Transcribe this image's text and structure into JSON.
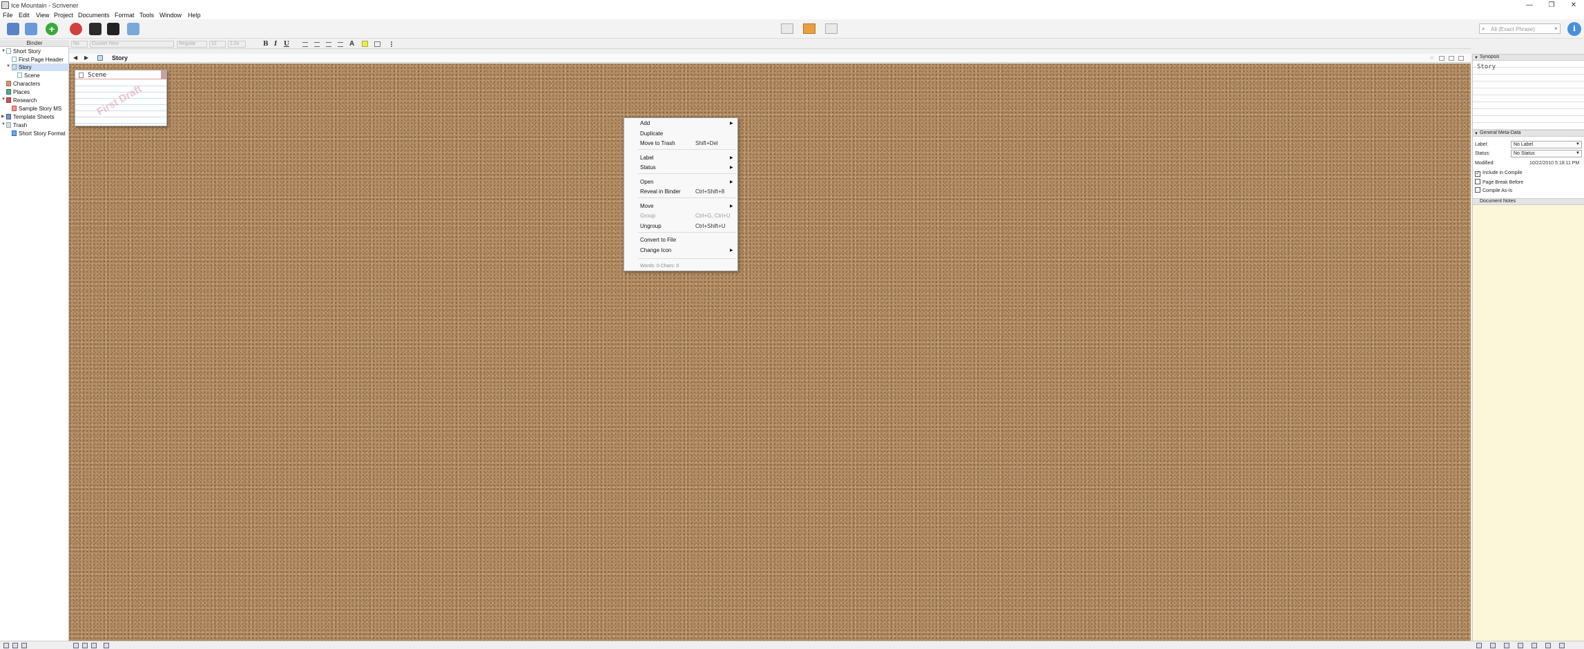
{
  "window": {
    "title": "Ice Mountain - Scrivener",
    "controls": {
      "minimize": "—",
      "maximize": "❐",
      "close": "✕"
    }
  },
  "menubar": [
    "File",
    "Edit",
    "View",
    "Project",
    "Documents",
    "Format",
    "Tools",
    "Window",
    "Help"
  ],
  "toolbar": {
    "search_placeholder": "All (Exact Phrase)",
    "info_label": "i",
    "colors": {
      "add": "#3aa83a",
      "remove": "#d04040",
      "info": "#4a90d9",
      "view_active": "#e8a040"
    }
  },
  "binder": {
    "header": "Binder",
    "items": [
      {
        "label": "Short Story"
      },
      {
        "label": "First Page Header"
      },
      {
        "label": "Story"
      },
      {
        "label": "Scene"
      },
      {
        "label": "Characters"
      },
      {
        "label": "Places"
      },
      {
        "label": "Research"
      },
      {
        "label": "Sample Story MS"
      },
      {
        "label": "Template Sheets"
      },
      {
        "label": "Trash"
      },
      {
        "label": "Short Story Format"
      }
    ]
  },
  "formatbar": {
    "style": "No",
    "font": "Courier New",
    "weight": "Regular",
    "size": "12",
    "spacing": "1.0x",
    "bold": "B",
    "italic": "I",
    "underline": "U"
  },
  "editor": {
    "back": "◀",
    "forward": "▶",
    "title": "Story"
  },
  "corkboard": {
    "cards": [
      {
        "title": "Scene",
        "stamp": "First Draft"
      }
    ]
  },
  "context_menu": {
    "items": [
      {
        "label": "Add",
        "shortcut": "",
        "submenu": true,
        "disabled": false
      },
      {
        "label": "Duplicate",
        "shortcut": "",
        "submenu": false,
        "disabled": false
      },
      {
        "label": "Move to Trash",
        "shortcut": "Shift+Del",
        "submenu": false,
        "disabled": false
      },
      {
        "label": "Label",
        "shortcut": "",
        "submenu": true,
        "disabled": false
      },
      {
        "label": "Status",
        "shortcut": "",
        "submenu": true,
        "disabled": false
      },
      {
        "label": "Open",
        "shortcut": "",
        "submenu": true,
        "disabled": false
      },
      {
        "label": "Reveal in Binder",
        "shortcut": "Ctrl+Shift+8",
        "submenu": false,
        "disabled": false
      },
      {
        "label": "Move",
        "shortcut": "",
        "submenu": true,
        "disabled": false
      },
      {
        "label": "Group",
        "shortcut": "Ctrl+G, Ctrl+U",
        "submenu": false,
        "disabled": true
      },
      {
        "label": "Ungroup",
        "shortcut": "Ctrl+Shift+U",
        "submenu": false,
        "disabled": false
      },
      {
        "label": "Convert to File",
        "shortcut": "",
        "submenu": false,
        "disabled": false
      },
      {
        "label": "Change Icon",
        "shortcut": "",
        "submenu": true,
        "disabled": false
      }
    ],
    "stats": "Words: 0    Chars: 0"
  },
  "inspector": {
    "synopsis_header": "Synopsis",
    "synopsis_text": "Story",
    "metadata_header": "General Meta-Data",
    "label_caption": "Label:",
    "label_value": "No Label",
    "status_caption": "Status:",
    "status_value": "No Status",
    "modified_caption": "Modified:",
    "modified_value": "10/22/2010 5:18:11 PM",
    "checkboxes": [
      {
        "label": "Include in Compile",
        "checked": true
      },
      {
        "label": "Page Break Before",
        "checked": false
      },
      {
        "label": "Compile As-Is",
        "checked": false
      }
    ],
    "notes_header": "Document Notes",
    "notes_bg": "#fdf7d9"
  }
}
